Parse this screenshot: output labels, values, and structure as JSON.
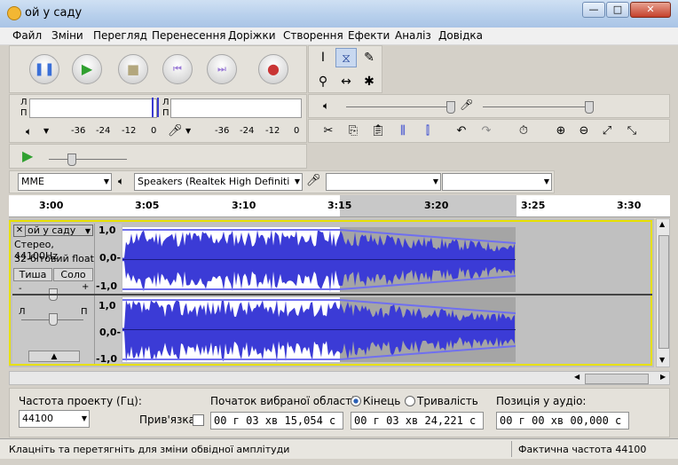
{
  "window": {
    "title": "ой у саду",
    "min": "—",
    "max": "□",
    "close": "✕"
  },
  "menu": [
    "Файл",
    "Зміни",
    "Перегляд",
    "Перенесення",
    "Доріжки",
    "Створення",
    "Ефекти",
    "Аналіз",
    "Довідка"
  ],
  "meters": {
    "left": "Л",
    "right": "П",
    "scale": [
      "-36",
      "-24",
      "-12",
      "0"
    ]
  },
  "devices": {
    "host": "MME",
    "output": "Speakers (Realtek High Definiti",
    "input": "",
    "channels": ""
  },
  "ruler": [
    "3:00",
    "3:05",
    "3:10",
    "3:15",
    "3:20",
    "3:25",
    "3:30"
  ],
  "track": {
    "name": "ой у саду",
    "info1": "Стерео, 44100Hz",
    "info2": "32-бітовий float",
    "mute": "Тиша",
    "solo": "Соло",
    "gain_minus": "-",
    "gain_plus": "+",
    "pan_left": "Л",
    "pan_right": "П",
    "scale": [
      "1,0",
      "0,0-",
      "-1,0",
      "1,0",
      "0,0-",
      "-1,0"
    ]
  },
  "selection": {
    "rate_label": "Частота проекту (Гц):",
    "rate_value": "44100",
    "snap_label": "Прив'язка",
    "start_label": "Початок вибраної області:",
    "end_label": "Кінець",
    "length_label": "Тривалість",
    "start_value": "00 г 03 хв 15,054 с",
    "end_value": "00 г 03 хв 24,221 с",
    "pos_label": "Позиція у аудіо:",
    "pos_value": "00 г 00 хв 00,000 с"
  },
  "status": {
    "message": "Клацніть та перетягніть для зміни обвідної амплітуди",
    "rate": "Фактична частота 44100"
  },
  "colors": {
    "waveform": "#3b3bd6",
    "selection": "#a5a5a5",
    "envelope": "#6f6ff0"
  }
}
